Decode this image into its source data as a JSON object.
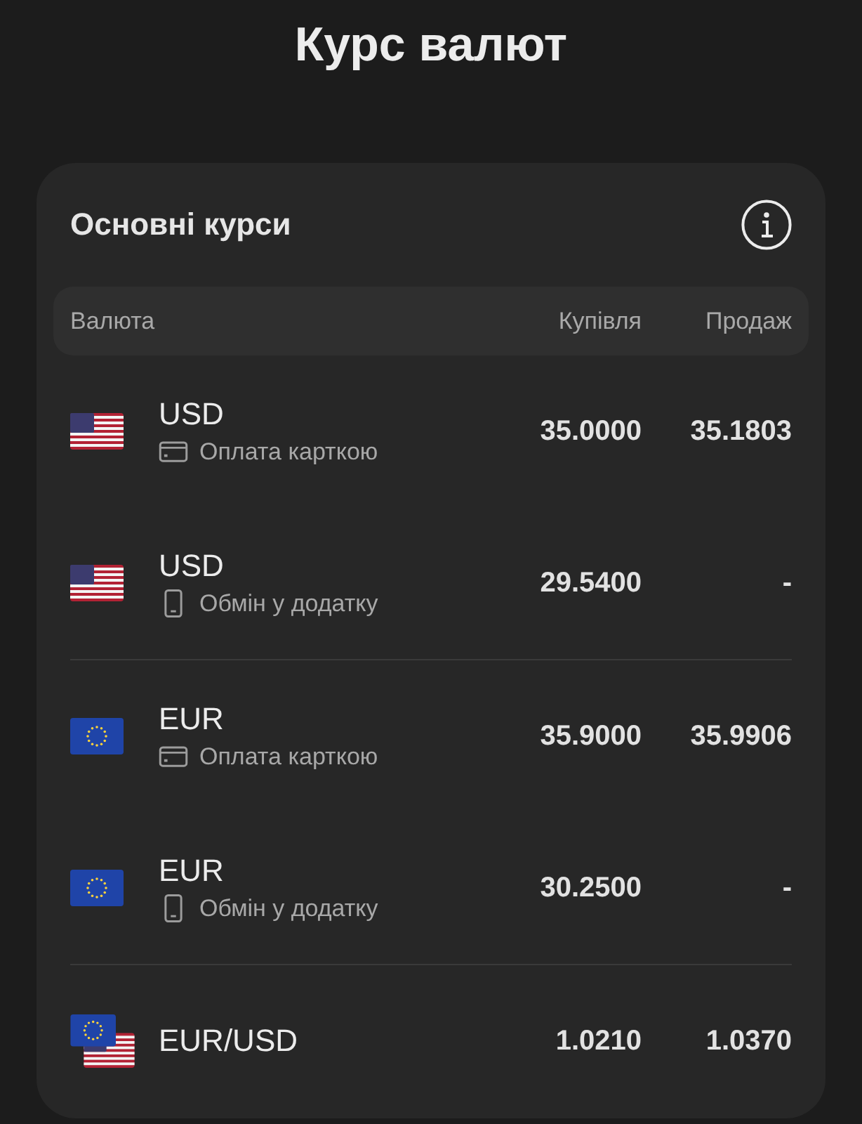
{
  "title": "Курс валют",
  "card": {
    "title": "Основні курси",
    "columns": [
      "Валюта",
      "Купівля",
      "Продаж"
    ],
    "groups": [
      {
        "rows": [
          {
            "kind": "us",
            "code": "USD",
            "method": {
              "kind": "card",
              "label": "Оплата карткою"
            },
            "buy": "35.0000",
            "sell": "35.1803"
          },
          {
            "kind": "us",
            "code": "USD",
            "method": {
              "kind": "phone",
              "label": "Обмін у додатку"
            },
            "buy": "29.5400",
            "sell": "-"
          }
        ]
      },
      {
        "rows": [
          {
            "kind": "eu",
            "code": "EUR",
            "method": {
              "kind": "card",
              "label": "Оплата карткою"
            },
            "buy": "35.9000",
            "sell": "35.9906"
          },
          {
            "kind": "eu",
            "code": "EUR",
            "method": {
              "kind": "phone",
              "label": "Обмін у додатку"
            },
            "buy": "30.2500",
            "sell": "-"
          }
        ]
      },
      {
        "rows": [
          {
            "kind": "pair",
            "code": "EUR/USD",
            "buy": "1.0210",
            "sell": "1.0370"
          }
        ]
      }
    ]
  }
}
